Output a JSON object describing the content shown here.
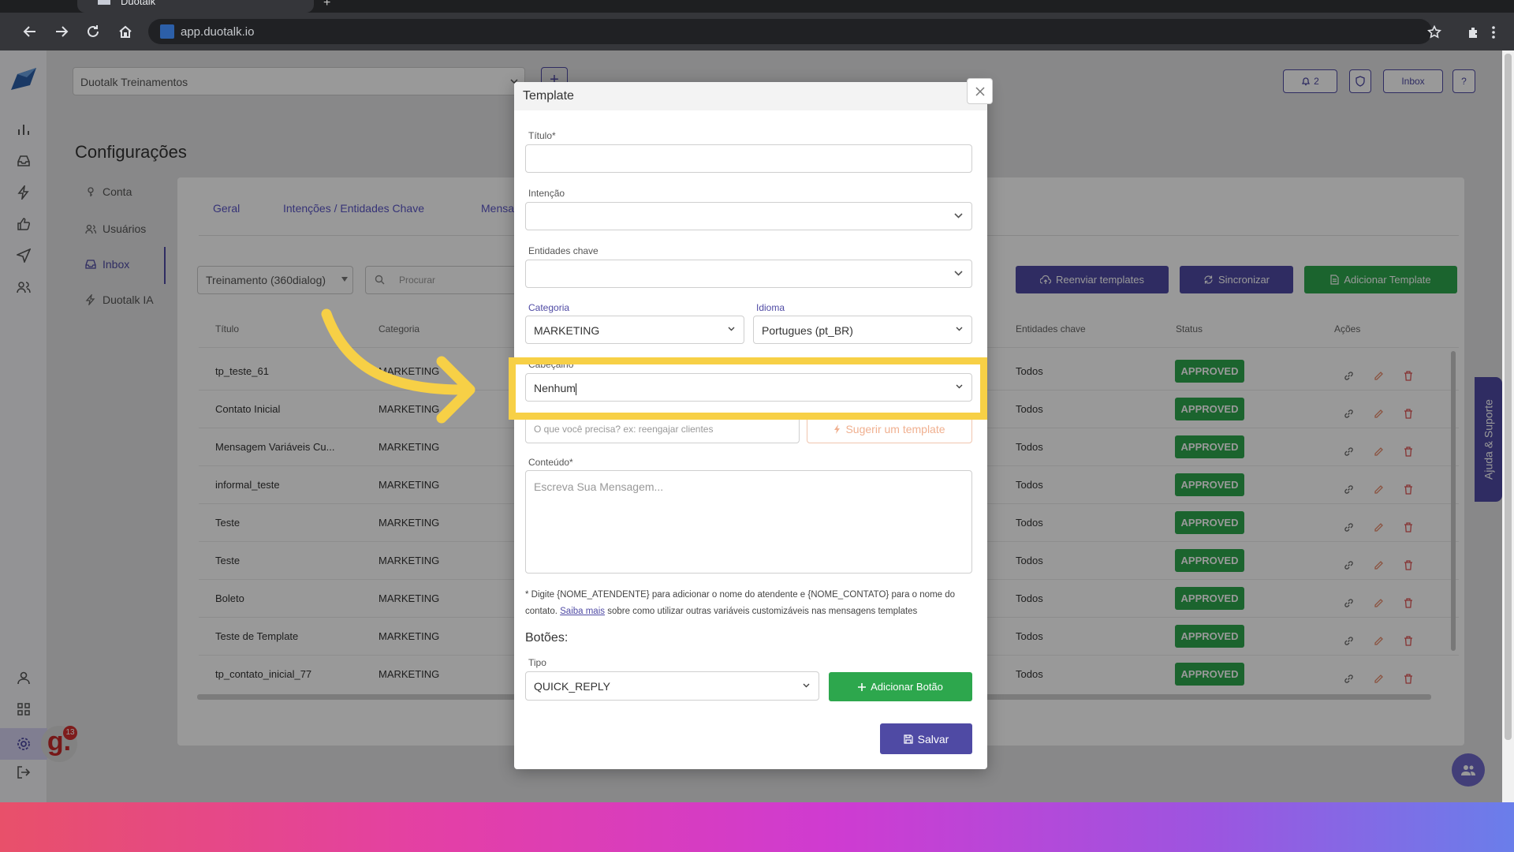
{
  "browser": {
    "tab_title": "Duotalk",
    "url": "app.duotalk.io"
  },
  "header": {
    "workspace": "Duotalk Treinamentos",
    "plus": "+",
    "notifications_count": "2",
    "inbox_label": "Inbox",
    "help_label": "?"
  },
  "page": {
    "title": "Configurações"
  },
  "config_menu": {
    "items": [
      {
        "label": "Conta",
        "icon": "key-icon"
      },
      {
        "label": "Usuários",
        "icon": "users-icon"
      },
      {
        "label": "Inbox",
        "icon": "inbox-icon"
      },
      {
        "label": "Duotalk IA",
        "icon": "bolt-icon"
      }
    ]
  },
  "tabs": [
    "Geral",
    "Intenções / Entidades Chave",
    "Mensa"
  ],
  "filters": {
    "channel": "Treinamento (360dialog)",
    "search_placeholder": "Procurar"
  },
  "actions": {
    "resend": "Reenviar templates",
    "sync": "Sincronizar",
    "add_template": "Adicionar Template"
  },
  "table": {
    "headers": {
      "title": "Título",
      "category": "Categoria",
      "entities": "Entidades chave",
      "status": "Status",
      "actions": "Ações"
    },
    "rows": [
      {
        "title": "tp_teste_61",
        "category": "MARKETING",
        "entities": "Todos",
        "status": "APPROVED"
      },
      {
        "title": "Contato Inicial",
        "category": "MARKETING",
        "entities": "Todos",
        "status": "APPROVED"
      },
      {
        "title": "Mensagem Variáveis Cu...",
        "category": "MARKETING",
        "entities": "Todos",
        "status": "APPROVED"
      },
      {
        "title": "informal_teste",
        "category": "MARKETING",
        "entities": "Todos",
        "status": "APPROVED"
      },
      {
        "title": "Teste",
        "category": "MARKETING",
        "entities": "Todos",
        "status": "APPROVED"
      },
      {
        "title": "Teste",
        "category": "MARKETING",
        "entities": "Todos",
        "status": "APPROVED"
      },
      {
        "title": "Boleto",
        "category": "MARKETING",
        "entities": "Todos",
        "status": "APPROVED"
      },
      {
        "title": "Teste de Template",
        "category": "MARKETING",
        "entities": "Todos",
        "status": "APPROVED"
      },
      {
        "title": "tp_contato_inicial_77",
        "category": "MARKETING",
        "entities": "Todos",
        "status": "APPROVED"
      }
    ]
  },
  "help_tab": "Ajuda & Suporte",
  "logo_badge": "13",
  "logo_letter": "g.",
  "modal": {
    "title": "Template",
    "titulo_label": "Título*",
    "titulo_value": "",
    "intencao_label": "Intenção",
    "entidades_label": "Entidades chave",
    "categoria_label": "Categoria",
    "categoria_value": "MARKETING",
    "idioma_label": "Idioma",
    "idioma_value": "Portugues (pt_BR)",
    "cabecalho_label": "Cabeçalho",
    "cabecalho_value": "Nenhum",
    "ai_placeholder": "O que você precisa? ex: reengajar clientes",
    "suggest_label": "Sugerir um template",
    "conteudo_label": "Conteúdo*",
    "conteudo_placeholder": "Escreva Sua Mensagem...",
    "note_part1": "* Digite {NOME_ATENDENTE} para adicionar o nome do atendente e {NOME_CONTATO} para o nome do contato.",
    "note_link": "Saiba mais",
    "note_part2": "sobre como utilizar outras variáveis customizáveis nas mensagens templates",
    "buttons_heading": "Botões:",
    "tipo_label": "Tipo",
    "tipo_value": "QUICK_REPLY",
    "add_button_label": "Adicionar Botão",
    "save_label": "Salvar"
  },
  "colors": {
    "brand": "#4f4aa4",
    "approved": "#2da74d",
    "highlight": "#f7d046"
  }
}
